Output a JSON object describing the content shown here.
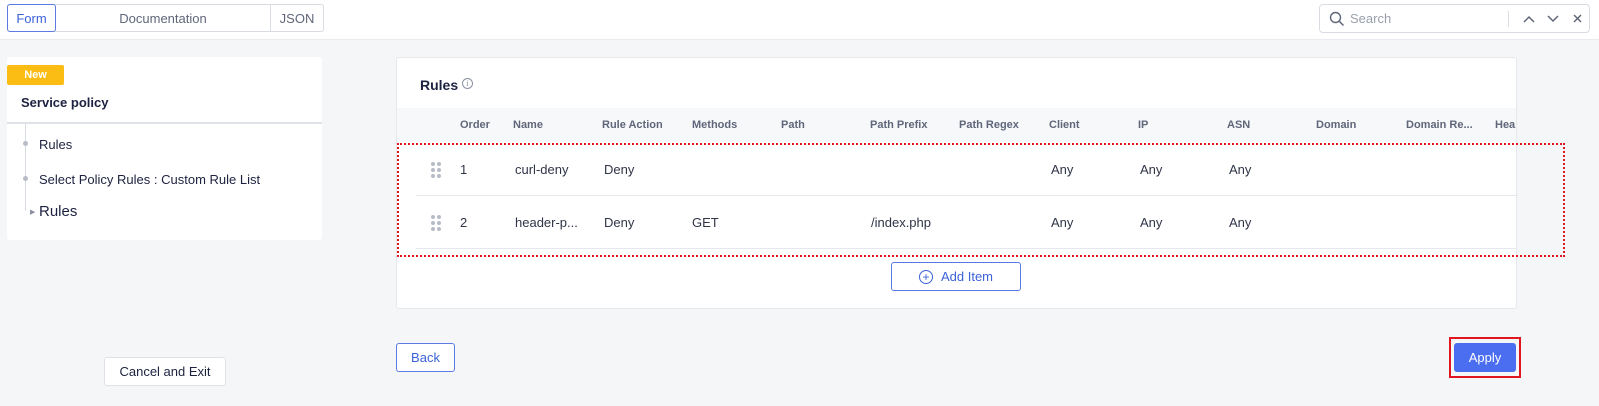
{
  "tabs": [
    {
      "label": "Form",
      "active": true
    },
    {
      "label": "Documentation",
      "active": false
    },
    {
      "label": "JSON",
      "active": false
    }
  ],
  "search": {
    "placeholder": "Search",
    "value": ""
  },
  "left_panel": {
    "badge": "New",
    "title": "Service policy",
    "tree": [
      {
        "label": "Rules"
      },
      {
        "label": "Select Policy Rules : Custom Rule List"
      },
      {
        "label": "Rules",
        "current": true
      }
    ],
    "cancel_label": "Cancel and Exit"
  },
  "rules": {
    "title": "Rules",
    "info_glyph": "i",
    "columns": [
      "Order",
      "Name",
      "Rule Action",
      "Methods",
      "Path",
      "Path Prefix",
      "Path Regex",
      "Client",
      "IP",
      "ASN",
      "Domain",
      "Domain Re...",
      "Hea"
    ],
    "rows": [
      {
        "order": "1",
        "name": "curl-deny",
        "action": "Deny",
        "methods": "",
        "path": "",
        "path_prefix": "",
        "path_regex": "",
        "client": "Any",
        "ip": "Any",
        "asn": "Any",
        "domain": "",
        "domain_regex": ""
      },
      {
        "order": "2",
        "name": "header-p...",
        "action": "Deny",
        "methods": "GET",
        "path": "",
        "path_prefix": "/index.php",
        "path_regex": "",
        "client": "Any",
        "ip": "Any",
        "asn": "Any",
        "domain": "",
        "domain_regex": ""
      }
    ],
    "add_label": "Add Item"
  },
  "footer": {
    "back_label": "Back",
    "apply_label": "Apply"
  },
  "colors": {
    "accent": "#4b6ef0",
    "badge": "#fbbd14",
    "highlight": "#e0151f"
  },
  "icons": {
    "search": "search-icon",
    "up": "chevron-up-icon",
    "down": "chevron-down-icon",
    "close": "close-icon",
    "drag": "drag-handle-icon",
    "add": "plus-circle-icon",
    "info": "info-icon"
  }
}
